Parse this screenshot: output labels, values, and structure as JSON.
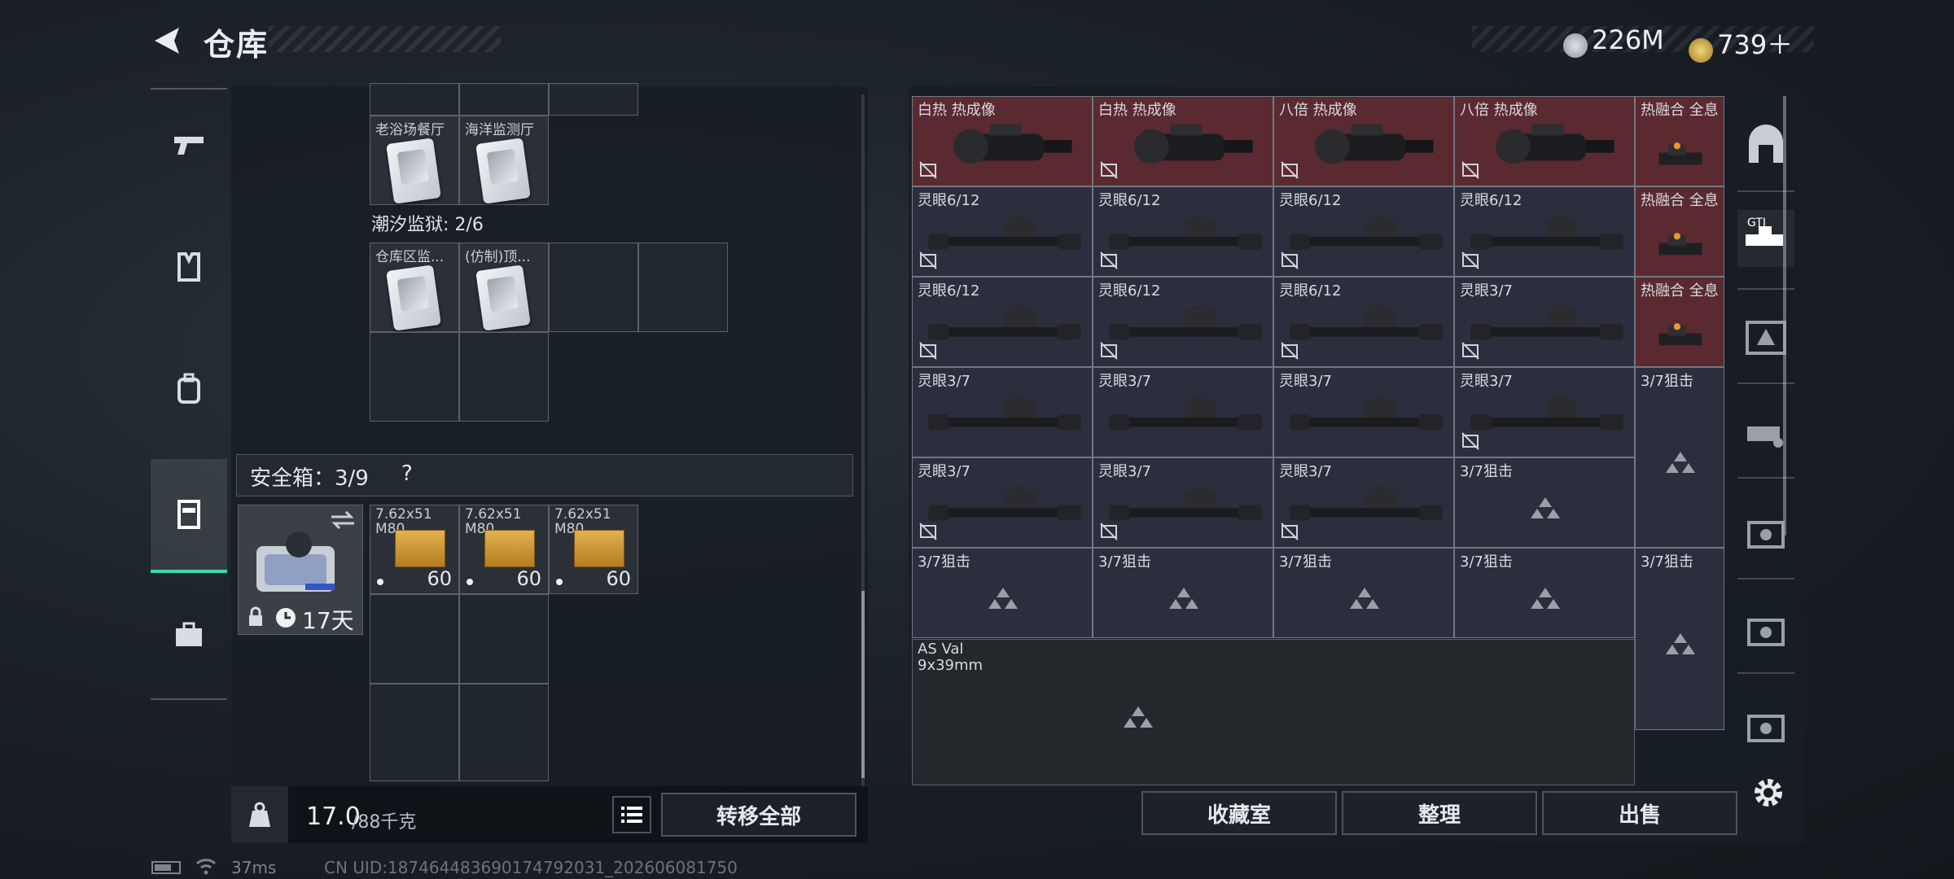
{
  "header": {
    "title": "仓库",
    "currency_1": "226M",
    "currency_2": "739＋"
  },
  "left": {
    "top_cards": [
      {
        "label": "老浴场餐厅"
      },
      {
        "label": "海洋监测厅"
      }
    ],
    "section_title": "潮汐监狱: 2/6",
    "section_cards": [
      {
        "label": "仓库区监..."
      },
      {
        "label": "(仿制)顶..."
      }
    ],
    "safebox": {
      "label": "安全箱：3/9",
      "help": "?",
      "days": "17天"
    },
    "ammo": [
      {
        "name": "7.62x51\nM80",
        "count": "60"
      },
      {
        "name": "7.62x51\nM80",
        "count": "60"
      },
      {
        "name": "7.62x51\nM80",
        "count": "60"
      }
    ],
    "weight_value": "17.0",
    "weight_max": "/88千克",
    "transfer_label": "转移全部"
  },
  "grid": {
    "rows": [
      [
        "白热 热成像",
        "白热 热成像",
        "八倍 热成像",
        "八倍 热成像",
        "热融合 全息"
      ],
      [
        "灵眼6/12",
        "灵眼6/12",
        "灵眼6/12",
        "灵眼6/12",
        "热融合 全息"
      ],
      [
        "灵眼6/12",
        "灵眼6/12",
        "灵眼6/12",
        "灵眼3/7",
        "热融合 全息"
      ],
      [
        "灵眼3/7",
        "灵眼3/7",
        "灵眼3/7",
        "灵眼3/7",
        "3/7狙击"
      ],
      [
        "灵眼3/7",
        "灵眼3/7",
        "灵眼3/7",
        "3/7狙击",
        ""
      ],
      [
        "3/7狙击",
        "3/7狙击",
        "3/7狙击",
        "3/7狙击",
        "3/7狙击"
      ]
    ],
    "asval": "AS Val\n9x39mm"
  },
  "buttons": {
    "collection": "收藏室",
    "organize": "整理",
    "sell": "出售"
  },
  "status": {
    "ping": "37ms",
    "uid": "CN UID:1874644836901747920​31_202606081750"
  },
  "colors": {
    "accent": "#3fd7b6",
    "red_cell": "#5b2a30",
    "blue_cell": "#2c2e3d"
  }
}
